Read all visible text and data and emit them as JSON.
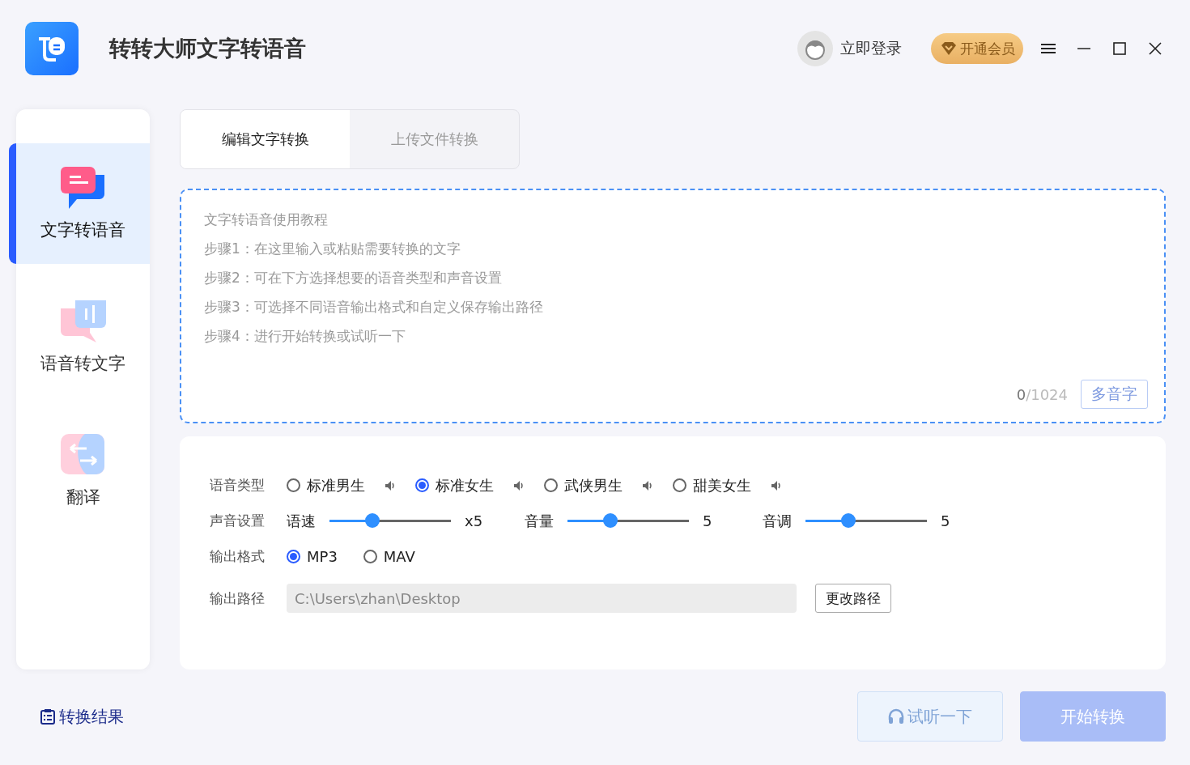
{
  "app": {
    "title": "转转大师文字转语音"
  },
  "header": {
    "login": "立即登录",
    "vip": "开通会员"
  },
  "sidebar": {
    "items": [
      {
        "label": "文字转语音",
        "kind": "text",
        "selected": true
      },
      {
        "label": "语音转文字",
        "kind": "voice",
        "selected": false
      },
      {
        "label": "翻译",
        "kind": "translate",
        "selected": false
      }
    ],
    "results_link": "转换结果"
  },
  "tabs": [
    {
      "label": "编辑文字转换",
      "selected": true
    },
    {
      "label": "上传文件转换",
      "selected": false
    }
  ],
  "editor": {
    "placeholder": [
      "文字转语音使用教程",
      "步骤1：在这里输入或粘贴需要转换的文字",
      "步骤2：可在下方选择想要的语音类型和声音设置",
      "步骤3：可选择不同语音输出格式和自定义保存输出路径",
      "步骤4：进行开始转换或试听一下"
    ],
    "count": "0",
    "limit": "/1024",
    "polyphone_button": {
      "label": "多音字",
      "disabled": true
    }
  },
  "settings": {
    "voice_type": {
      "label": "语音类型",
      "options": [
        {
          "label": "标准男生",
          "selected": false
        },
        {
          "label": "标准女生",
          "selected": true
        },
        {
          "label": "武侠男生",
          "selected": false
        },
        {
          "label": "甜美女生",
          "selected": false
        }
      ]
    },
    "sound": {
      "label": "声音设置",
      "sliders": [
        {
          "label": "语速",
          "level": 0.35,
          "reading": "x5"
        },
        {
          "label": "音量",
          "level": 0.35,
          "reading": "5"
        },
        {
          "label": "音调",
          "level": 0.35,
          "reading": "5"
        }
      ]
    },
    "format": {
      "label": "输出格式",
      "options": [
        {
          "label": "MP3",
          "selected": true
        },
        {
          "label": "MAV",
          "selected": false
        }
      ]
    },
    "path": {
      "label": "输出路径",
      "value": "C:\\Users\\zhan\\Desktop",
      "button": "更改路径"
    }
  },
  "actions": [
    {
      "label": "试听一下",
      "kind": "preview",
      "disabled": true
    },
    {
      "label": "开始转换",
      "kind": "start",
      "disabled": true
    }
  ]
}
